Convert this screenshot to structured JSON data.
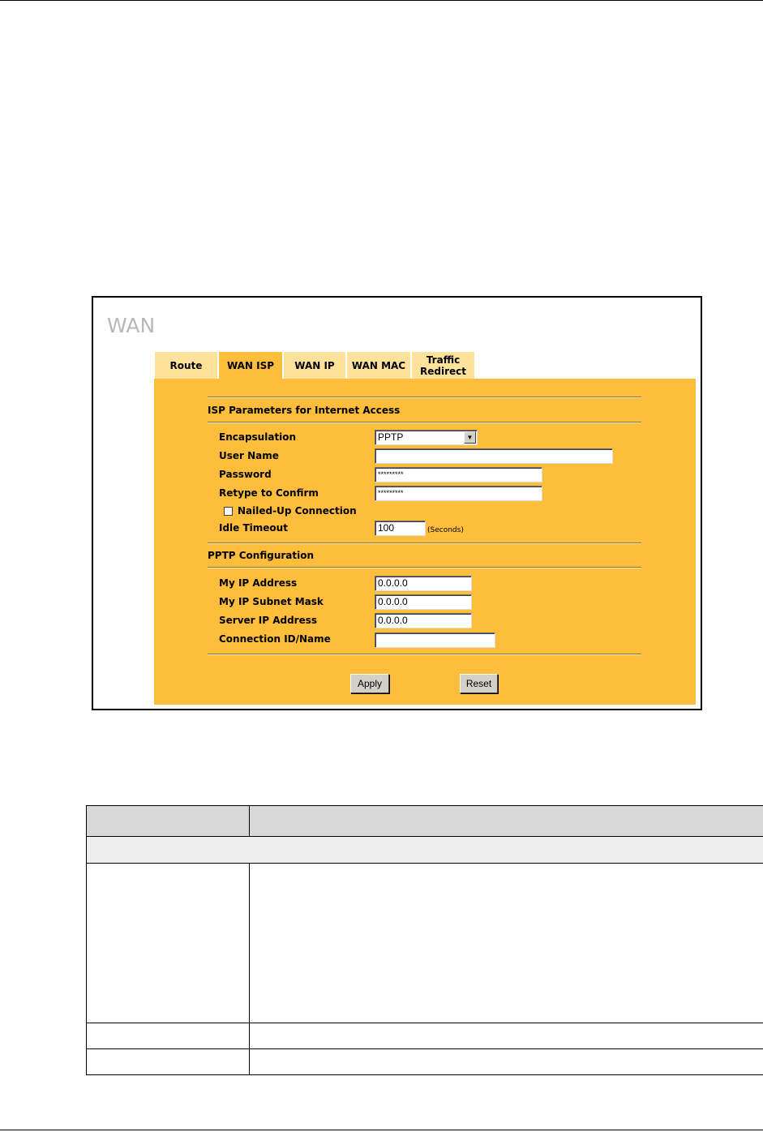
{
  "screenshot": {
    "title": "WAN",
    "tabs": [
      {
        "label": "Route",
        "active": false
      },
      {
        "label": "WAN ISP",
        "active": true
      },
      {
        "label": "WAN IP",
        "active": false
      },
      {
        "label": "WAN MAC",
        "active": false
      },
      {
        "label": "Traffic Redirect",
        "active": false
      }
    ],
    "isp_section": {
      "title": "ISP Parameters for Internet Access",
      "encapsulation_label": "Encapsulation",
      "encapsulation_value": "PPTP",
      "user_name_label": "User Name",
      "user_name_value": "",
      "password_label": "Password",
      "password_value": "*********",
      "retype_label": "Retype to Confirm",
      "retype_value": "*********",
      "nailed_up_label": "Nailed-Up Connection",
      "nailed_up_checked": false,
      "idle_timeout_label": "Idle Timeout",
      "idle_timeout_value": "100",
      "idle_timeout_unit": "(Seconds)"
    },
    "pptp_section": {
      "title": "PPTP Configuration",
      "my_ip_label": "My IP Address",
      "my_ip_value": "0.0.0.0",
      "subnet_label": "My IP Subnet Mask",
      "subnet_value": "0.0.0.0",
      "server_ip_label": "Server IP Address",
      "server_ip_value": "0.0.0.0",
      "conn_id_label": "Connection ID/Name",
      "conn_id_value": ""
    },
    "buttons": {
      "apply": "Apply",
      "reset": "Reset"
    }
  },
  "colors": {
    "panel": "#ffbd3c",
    "tab_inactive": "#fde29b",
    "title_gray": "#b8b8b8"
  }
}
